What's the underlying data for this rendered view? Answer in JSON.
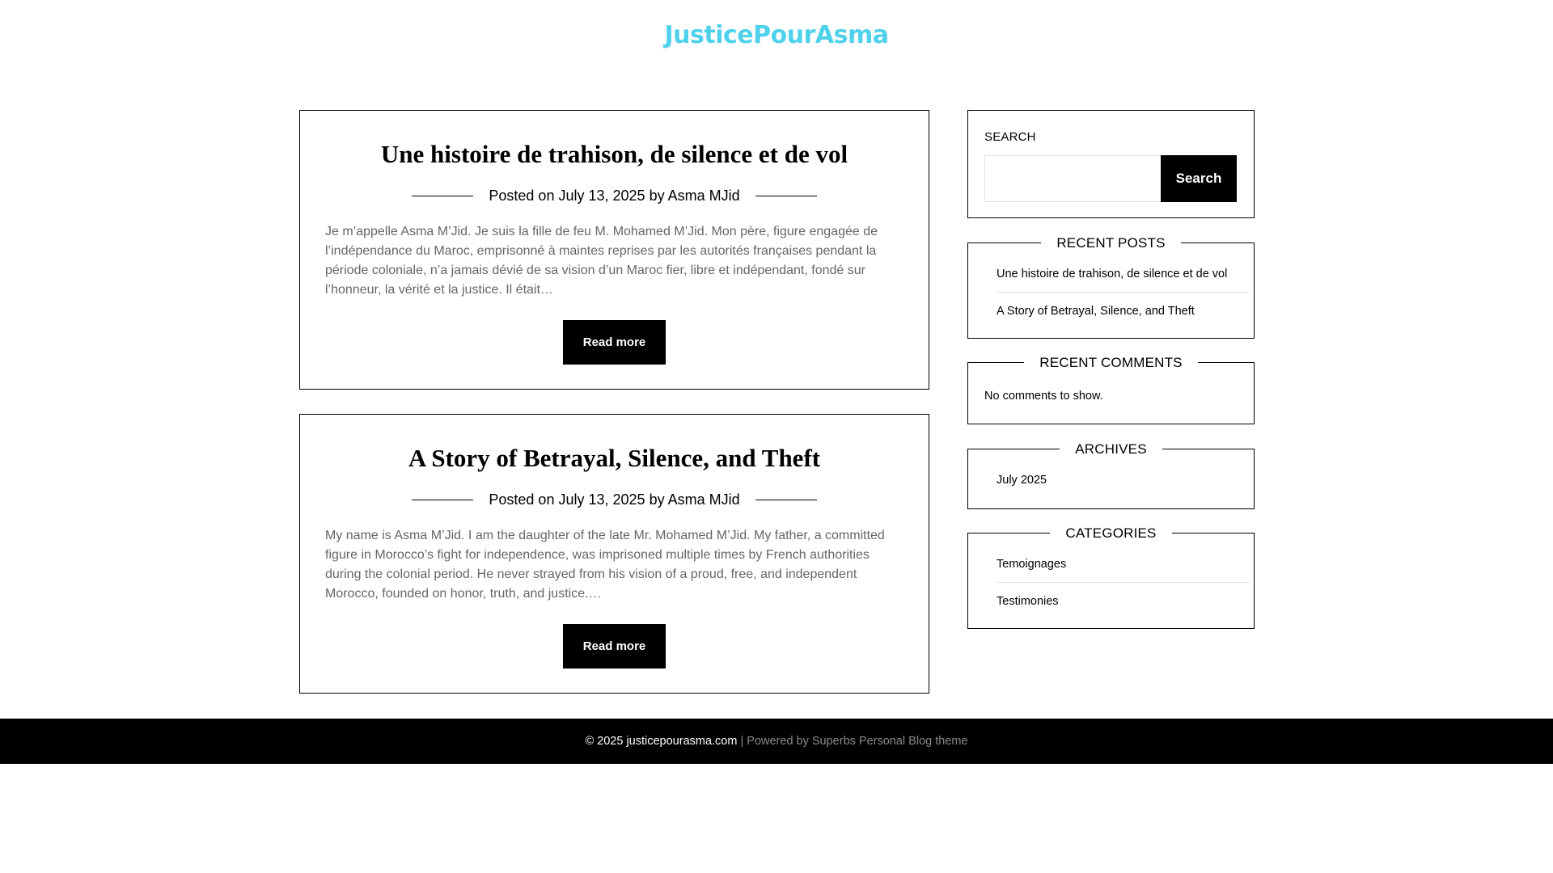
{
  "site": {
    "title": "JusticePourAsma",
    "accent_color": "#4fd1ec"
  },
  "posts": [
    {
      "title": "Une histoire de trahison, de silence et de vol",
      "posted_on_label": "Posted on",
      "date": "July 13, 2025",
      "by_label": "by",
      "author": "Asma MJid",
      "excerpt": "Je m’appelle Asma M’Jid. Je suis la fille de feu M. Mohamed M’Jid. Mon père, figure engagée de l’indépendance du Maroc, emprisonné à maintes reprises par les autorités françaises pendant la période coloniale, n’a jamais dévié de sa vision d’un Maroc fier, libre et indépendant, fondé sur l’honneur, la vérité et la justice. Il était…",
      "read_more": "Read more"
    },
    {
      "title": "A Story of Betrayal, Silence, and Theft",
      "posted_on_label": "Posted on",
      "date": "July 13, 2025",
      "by_label": "by",
      "author": "Asma MJid",
      "excerpt": "My name is Asma M’Jid. I am the daughter of the late Mr. Mohamed M’Jid. My father, a committed figure in Morocco’s fight for independence, was imprisoned multiple times by French authorities during the colonial period. He never strayed from his vision of a proud, free, and independent Morocco, founded on honor, truth, and justice.…",
      "read_more": "Read more"
    }
  ],
  "sidebar": {
    "search": {
      "label": "SEARCH",
      "placeholder": "",
      "button": "Search"
    },
    "recent_posts": {
      "title": "RECENT POSTS",
      "items": [
        "Une histoire de trahison, de silence et de vol",
        "A Story of Betrayal, Silence, and Theft"
      ]
    },
    "recent_comments": {
      "title": "RECENT COMMENTS",
      "empty_text": "No comments to show."
    },
    "archives": {
      "title": "ARCHIVES",
      "items": [
        "July 2025"
      ]
    },
    "categories": {
      "title": "CATEGORIES",
      "items": [
        "Temoignages",
        "Testimonies"
      ]
    }
  },
  "footer": {
    "copyright": "© 2025 justicepourasma.com",
    "separator": " | ",
    "powered_by": "Powered by Superbs Personal Blog theme"
  }
}
